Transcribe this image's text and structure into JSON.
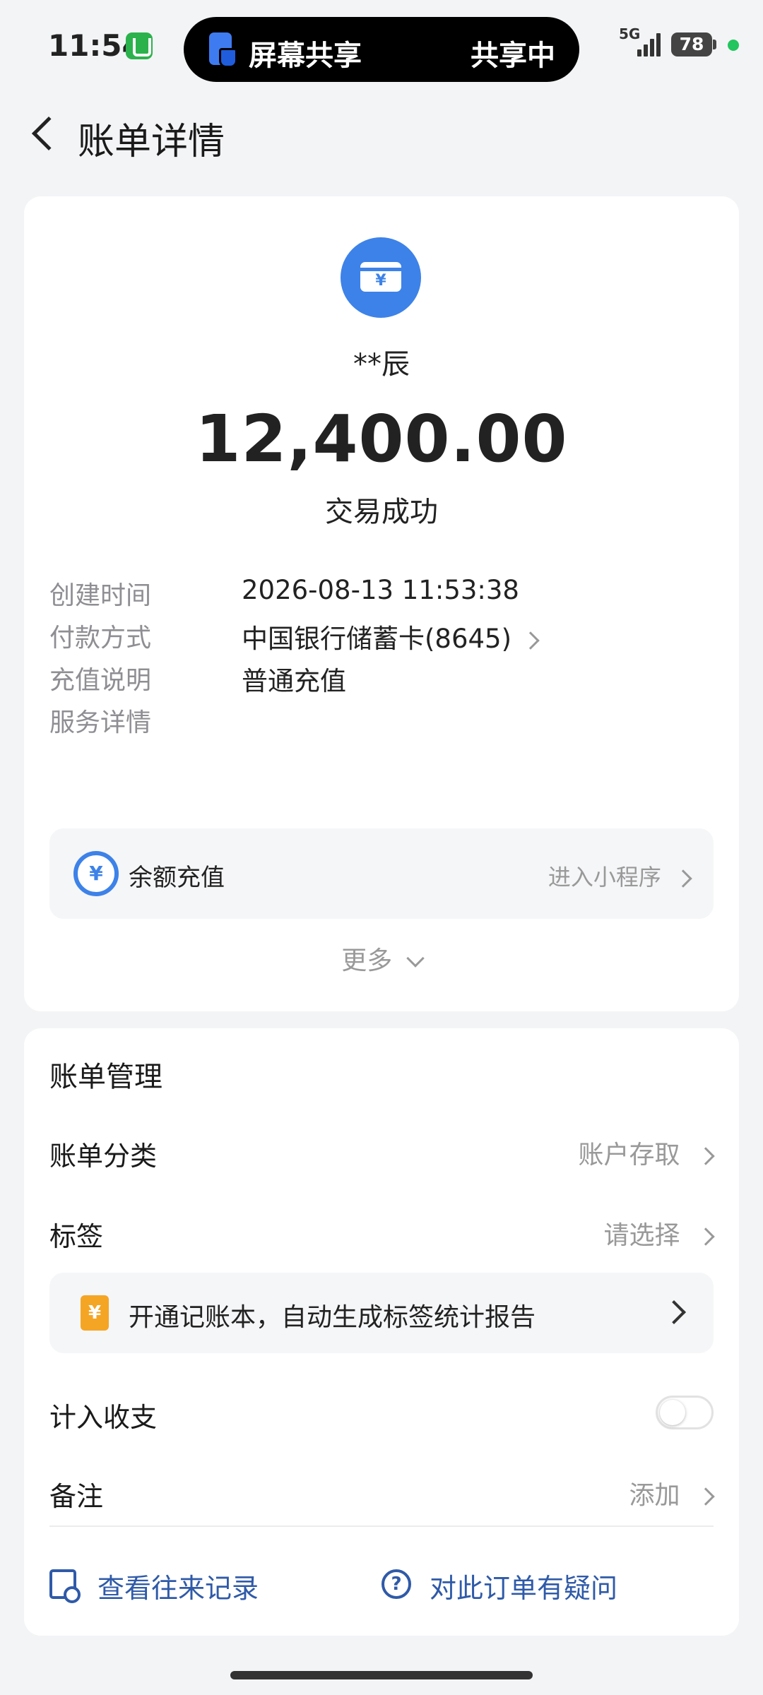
{
  "status_bar": {
    "time": "11:54",
    "screen_share_label": "屏幕共享",
    "screen_share_status": "共享中",
    "network": "5G",
    "battery": "78"
  },
  "header": {
    "title": "账单详情"
  },
  "transaction": {
    "payee": "**辰",
    "amount": "12,400.00",
    "status": "交易成功"
  },
  "details": [
    {
      "label": "创建时间",
      "value": "2026-08-13 11:53:38"
    },
    {
      "label": "付款方式",
      "value": "中国银行储蓄卡(8645)"
    },
    {
      "label": "充值说明",
      "value": "普通充值"
    },
    {
      "label": "服务详情",
      "value": ""
    }
  ],
  "service": {
    "icon_glyph": "¥",
    "label": "余额充值",
    "link": "进入小程序"
  },
  "more_label": "更多",
  "bill_management": {
    "title": "账单管理",
    "category_label": "账单分类",
    "category_value": "账户存取",
    "tag_label": "标签",
    "tag_value": "请选择",
    "promo_icon_glyph": "¥",
    "promo_text": "开通记账本，自动生成标签统计报告",
    "include_label": "计入收支",
    "include_enabled": false,
    "note_label": "备注",
    "note_value": "添加"
  },
  "footer": {
    "history_label": "查看往来记录",
    "help_glyph": "?",
    "question_label": "对此订单有疑问"
  },
  "colors": {
    "accent_blue": "#3d82e8",
    "link_blue": "#2f5aa8",
    "coupon_orange": "#f5a524",
    "background": "#f3f4f6"
  }
}
